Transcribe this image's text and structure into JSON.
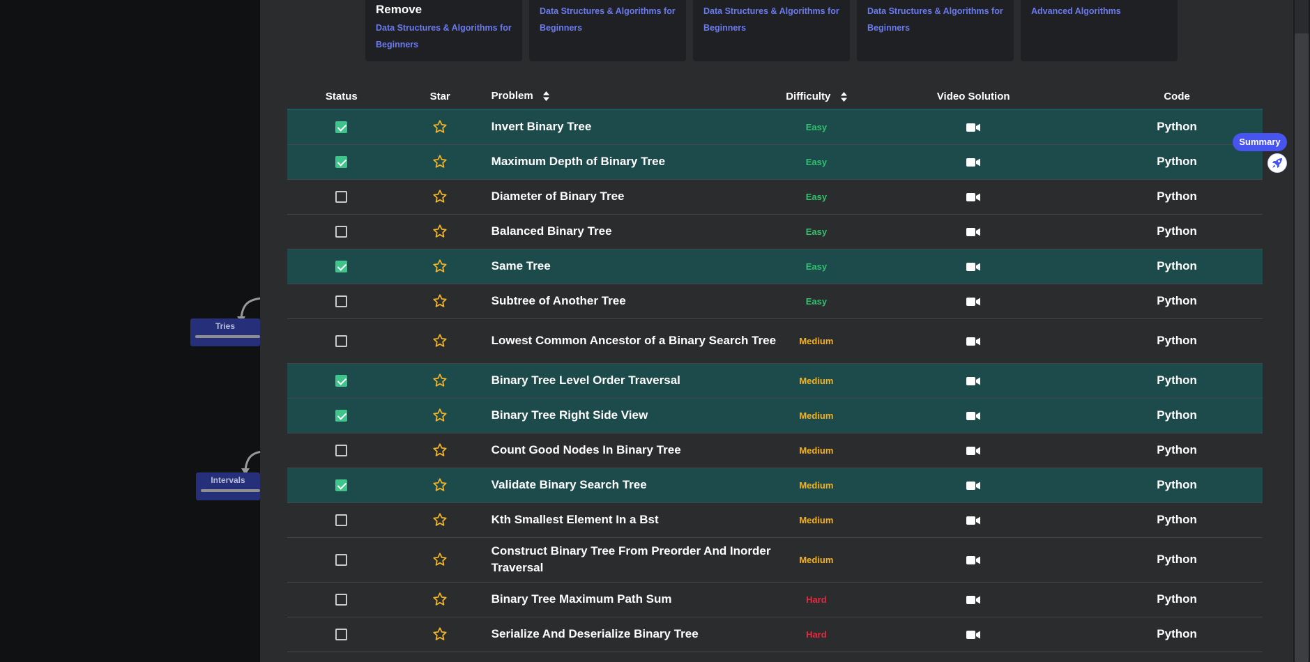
{
  "background_nodes": [
    {
      "label": "Tries"
    },
    {
      "label": "Intervals"
    }
  ],
  "roadmap_cards": [
    {
      "title": "Remove",
      "subtitle": "Data Structures & Algorithms for Beginners"
    },
    {
      "title": "",
      "subtitle": "Data Structures & Algorithms for Beginners"
    },
    {
      "title": "",
      "subtitle": "Data Structures & Algorithms for Beginners"
    },
    {
      "title": "",
      "subtitle": "Data Structures & Algorithms for Beginners"
    },
    {
      "title": "",
      "subtitle": "Advanced Algorithms"
    }
  ],
  "table": {
    "headers": {
      "status": "Status",
      "star": "Star",
      "problem": "Problem",
      "difficulty": "Difficulty",
      "video": "Video Solution",
      "code": "Code"
    },
    "rows": [
      {
        "completed": true,
        "problem": "Invert Binary Tree",
        "difficulty": "Easy",
        "code": "Python"
      },
      {
        "completed": true,
        "problem": "Maximum Depth of Binary Tree",
        "difficulty": "Easy",
        "code": "Python"
      },
      {
        "completed": false,
        "problem": "Diameter of Binary Tree",
        "difficulty": "Easy",
        "code": "Python"
      },
      {
        "completed": false,
        "problem": "Balanced Binary Tree",
        "difficulty": "Easy",
        "code": "Python"
      },
      {
        "completed": true,
        "problem": "Same Tree",
        "difficulty": "Easy",
        "code": "Python"
      },
      {
        "completed": false,
        "problem": "Subtree of Another Tree",
        "difficulty": "Easy",
        "code": "Python"
      },
      {
        "completed": false,
        "problem": "Lowest Common Ancestor of a Binary Search Tree",
        "difficulty": "Medium",
        "code": "Python"
      },
      {
        "completed": true,
        "problem": "Binary Tree Level Order Traversal",
        "difficulty": "Medium",
        "code": "Python"
      },
      {
        "completed": true,
        "problem": "Binary Tree Right Side View",
        "difficulty": "Medium",
        "code": "Python"
      },
      {
        "completed": false,
        "problem": "Count Good Nodes In Binary Tree",
        "difficulty": "Medium",
        "code": "Python"
      },
      {
        "completed": true,
        "problem": "Validate Binary Search Tree",
        "difficulty": "Medium",
        "code": "Python"
      },
      {
        "completed": false,
        "problem": "Kth Smallest Element In a Bst",
        "difficulty": "Medium",
        "code": "Python"
      },
      {
        "completed": false,
        "problem": "Construct Binary Tree From Preorder And Inorder Traversal",
        "difficulty": "Medium",
        "code": "Python"
      },
      {
        "completed": false,
        "problem": "Binary Tree Maximum Path Sum",
        "difficulty": "Hard",
        "code": "Python"
      },
      {
        "completed": false,
        "problem": "Serialize And Deserialize Binary Tree",
        "difficulty": "Hard",
        "code": "Python"
      }
    ]
  },
  "summary_button": {
    "label": "Summary"
  },
  "icons": {
    "star": "star-icon",
    "video": "video-camera-icon",
    "sort": "sort-icon",
    "rocket": "rocket-icon"
  },
  "colors": {
    "accent": "#4754f0",
    "completed_row": "#1d4a4b",
    "checkbox_on": "#3fc58c",
    "star": "#f0b429",
    "easy": "#2fc36d",
    "medium": "#f5b219",
    "hard": "#e8283f",
    "link": "#6a7bf0"
  }
}
